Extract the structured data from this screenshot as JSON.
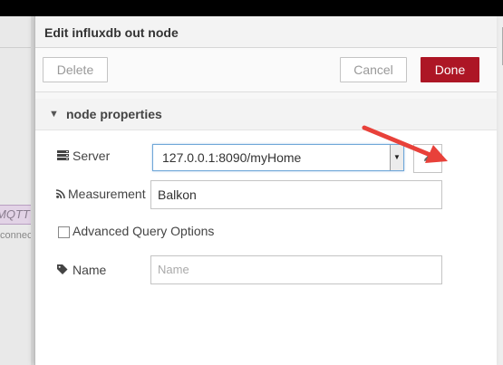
{
  "workspace": {
    "node_label": "MQTT",
    "node_status": "connected"
  },
  "dialog": {
    "title": "Edit influxdb out node",
    "toolbar": {
      "delete_label": "Delete",
      "cancel_label": "Cancel",
      "done_label": "Done"
    },
    "section": {
      "title": "node properties",
      "chevron": "▼"
    },
    "fields": {
      "server": {
        "label": "Server",
        "icon": "server-icon",
        "value": "127.0.0.1:8090/myHome",
        "edit_icon": "pencil-icon"
      },
      "measurement": {
        "label": "Measurement",
        "icon": "rss-icon",
        "value": "Balkon"
      },
      "advanced": {
        "label": "Advanced Query Options",
        "checked": false
      },
      "name": {
        "label": "Name",
        "icon": "tag-icon",
        "value": "",
        "placeholder": "Name"
      }
    }
  },
  "colors": {
    "done_button": "#ad1625",
    "annotation_arrow": "#e8413a",
    "focus_border": "#6fa7d8"
  }
}
